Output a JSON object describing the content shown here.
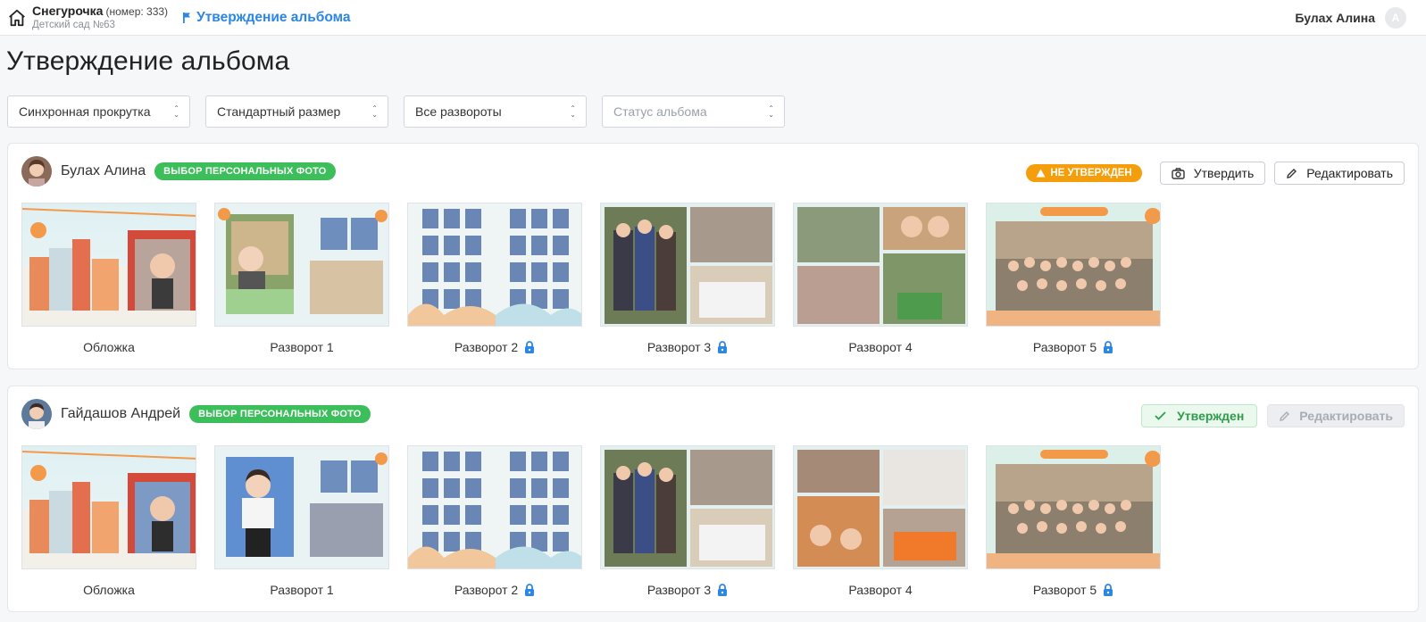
{
  "header": {
    "group_name": "Снегурочка",
    "group_number": "(номер: 333)",
    "kindergarten": "Детский сад №63",
    "breadcrumb": "Утверждение альбома",
    "user_name": "Булах Алина",
    "user_initial": "А"
  },
  "page_title": "Утверждение альбома",
  "filters": {
    "scroll": "Синхронная прокрутка",
    "size": "Стандартный размер",
    "spreads": "Все развороты",
    "status_placeholder": "Статус альбома"
  },
  "albums": [
    {
      "name": "Булах Алина",
      "badge": "ВЫБОР ПЕРСОНАЛЬНЫХ ФОТО",
      "status": "НЕ УТВЕРЖДЕН",
      "approve_label": "Утвердить",
      "edit_label": "Редактировать",
      "spreads": [
        "Обложка",
        "Разворот 1",
        "Разворот 2",
        "Разворот 3",
        "Разворот 4",
        "Разворот 5"
      ]
    },
    {
      "name": "Гайдашов Андрей",
      "badge": "ВЫБОР ПЕРСОНАЛЬНЫХ ФОТО",
      "status": "Утвержден",
      "edit_label": "Редактировать",
      "spreads": [
        "Обложка",
        "Разворот 1",
        "Разворот 2",
        "Разворот 3",
        "Разворот 4",
        "Разворот 5"
      ]
    }
  ],
  "colors": {
    "accent": "#2b86e4",
    "badge_green": "#3cbf5a",
    "badge_orange": "#f59e0b",
    "approved_text": "#2e9d4b"
  }
}
